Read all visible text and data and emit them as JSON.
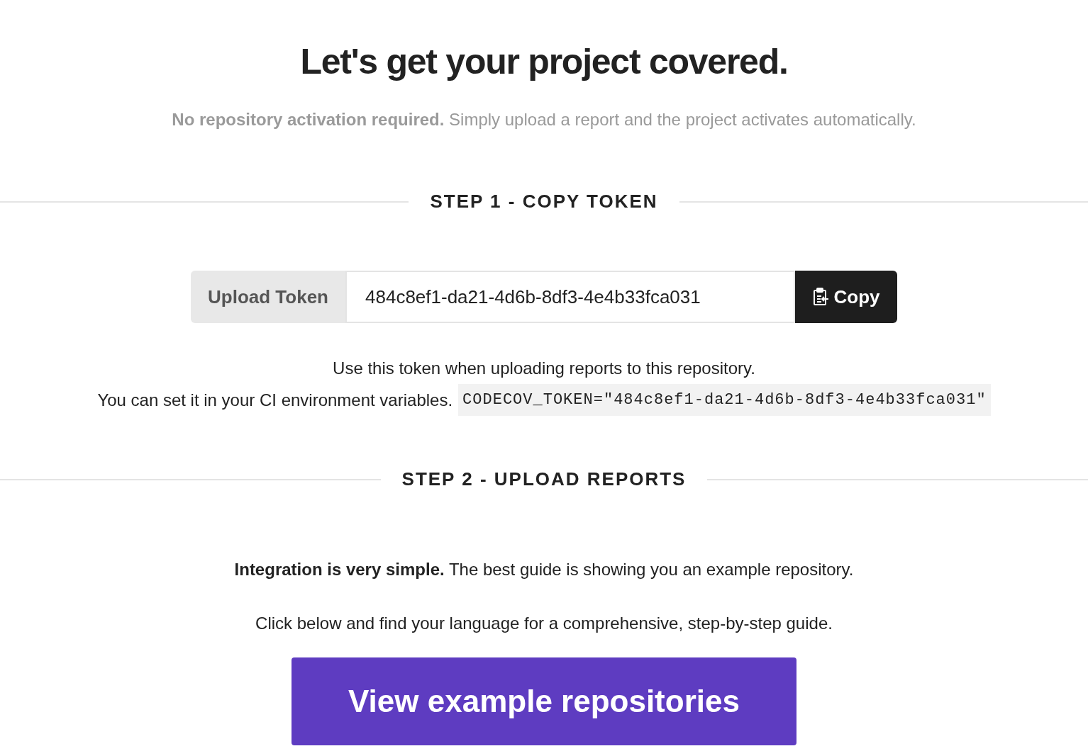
{
  "title": "Let's get your project covered.",
  "subtitle": "**No repository activation required.** Simply upload a report and the project activates automatically.",
  "step1": {
    "heading": "STEP 1 - COPY TOKEN",
    "token": {
      "label": "Upload Token",
      "value": "484c8ef1-da21-4d6b-8df3-4e4b33fca031",
      "button": "Copy"
    },
    "help": "Use this token when uploading reports to this repository.",
    "env_text": "You can set it in your CI environment variables.",
    "env_code": "CODECOV_TOKEN=\"484c8ef1-da21-4d6b-8df3-4e4b33fca031\""
  },
  "step2": {
    "heading": "STEP 2 - UPLOAD REPORTS",
    "paragraphs": [
      "**Integration is very simple.** The best guide is showing you an example repository.",
      "Click below and find your language for a comprehensive, step-by-step guide."
    ],
    "button": "View example repositories"
  }
}
